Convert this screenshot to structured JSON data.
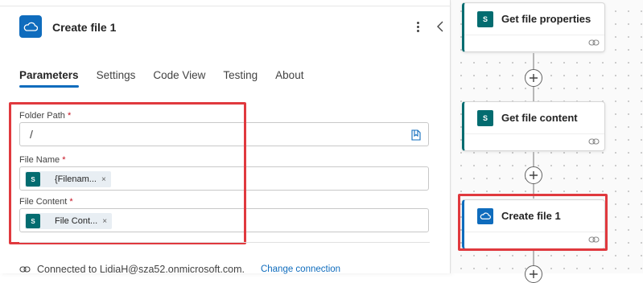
{
  "panel": {
    "title": "Create file 1",
    "tabs": [
      "Parameters",
      "Settings",
      "Code View",
      "Testing",
      "About"
    ],
    "fields": {
      "folder_path": {
        "label": "Folder Path",
        "required_mark": "*",
        "value": "/"
      },
      "file_name": {
        "label": "File Name",
        "required_mark": "*",
        "token": "{Filenam...",
        "token_remove": "×"
      },
      "file_content": {
        "label": "File Content",
        "required_mark": "*",
        "token": "File Cont...",
        "token_remove": "×"
      }
    },
    "connection": {
      "text": "Connected to LidiaH@sza52.onmicrosoft.com.",
      "change_label": "Change connection"
    }
  },
  "canvas": {
    "nodes": [
      {
        "title": "Get file properties",
        "icon": "sharepoint-icon"
      },
      {
        "title": "Get file content",
        "icon": "sharepoint-icon"
      },
      {
        "title": "Create file 1",
        "icon": "onedrive-icon"
      }
    ]
  },
  "colors": {
    "accent": "#0f6cbd",
    "sharepoint": "#036c70",
    "highlight": "#e0393e"
  }
}
